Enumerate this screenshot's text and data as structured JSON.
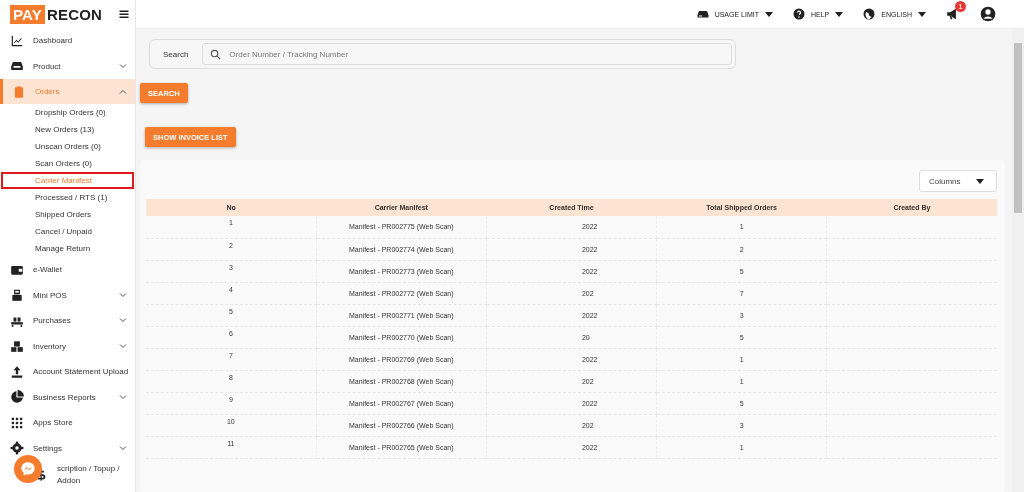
{
  "brand": {
    "logo_box": "PAY",
    "logo_rest": "RECON"
  },
  "topbar": {
    "menus": [
      {
        "label": "USAGE LIMIT"
      },
      {
        "label": "HELP"
      },
      {
        "label": "ENGLISH"
      }
    ],
    "notification_count": "1"
  },
  "sidebar": {
    "items": [
      {
        "kind": "link",
        "label": "Dashboard"
      },
      {
        "kind": "group",
        "label": "Product",
        "expanded": false
      },
      {
        "kind": "group",
        "label": "Orders",
        "expanded": true,
        "selected": true,
        "children": [
          {
            "label": "Dropship Orders (0)",
            "selected": false
          },
          {
            "label": "New Orders (13)",
            "selected": false
          },
          {
            "label": "Unscan Orders (0)",
            "selected": false
          },
          {
            "label": "Scan Orders (0)",
            "selected": false
          },
          {
            "label": "Carrier Manifest",
            "selected": true
          },
          {
            "label": "Processed / RTS (1)",
            "selected": false
          },
          {
            "label": "Shipped Orders",
            "selected": false
          },
          {
            "label": "Cancel / Unpaid",
            "selected": false
          },
          {
            "label": "Manage Return",
            "selected": false
          }
        ]
      },
      {
        "kind": "link",
        "label": "e-Wallet"
      },
      {
        "kind": "group",
        "label": "Mini POS",
        "expanded": false
      },
      {
        "kind": "group",
        "label": "Purchases",
        "expanded": false
      },
      {
        "kind": "group",
        "label": "Inventory",
        "expanded": false
      },
      {
        "kind": "link",
        "label": "Account Statement Upload"
      },
      {
        "kind": "group",
        "label": "Business Reports",
        "expanded": false
      },
      {
        "kind": "link",
        "label": "Apps Store"
      },
      {
        "kind": "group",
        "label": "Settings",
        "expanded": false
      },
      {
        "kind": "link",
        "label": "scription / Topup / Addon"
      }
    ]
  },
  "search": {
    "label": "Search",
    "placeholder": "Order Number / Tracking Number",
    "button": "SEARCH"
  },
  "invoice_button": "SHOW INVOICE LIST",
  "table": {
    "columns_button": "Columns",
    "columns": [
      "No",
      "Carrier Manifest",
      "Created Time",
      "Total Shipped Orders",
      "Created By"
    ],
    "rows": [
      [
        "1",
        "Manifest - PR002775 (Web Scan)",
        "2022",
        "1"
      ],
      [
        "2",
        "Manifest - PR002774 (Web Scan)",
        "2022",
        "2"
      ],
      [
        "3",
        "Manifest - PR002773 (Web Scan)",
        "2022",
        "5"
      ],
      [
        "4",
        "Manifest - PR002772 (Web Scan)",
        "202",
        "7"
      ],
      [
        "5",
        "Manifest - PR002771 (Web Scan)",
        "2022",
        "3"
      ],
      [
        "6",
        "Manifest - PR002770 (Web Scan)",
        "20",
        "5"
      ],
      [
        "7",
        "Manifest - PR002769 (Web Scan)",
        "2022",
        "1"
      ],
      [
        "8",
        "Manifest - PR002768 (Web Scan)",
        "202",
        "1"
      ],
      [
        "9",
        "Manifest - PR002767 (Web Scan)",
        "2022",
        "5"
      ],
      [
        "10",
        "Manifest - PR002766 (Web Scan)",
        "202",
        "3"
      ],
      [
        "11",
        "Manifest - PR002765 (Web Scan)",
        "2022",
        "1"
      ]
    ]
  }
}
